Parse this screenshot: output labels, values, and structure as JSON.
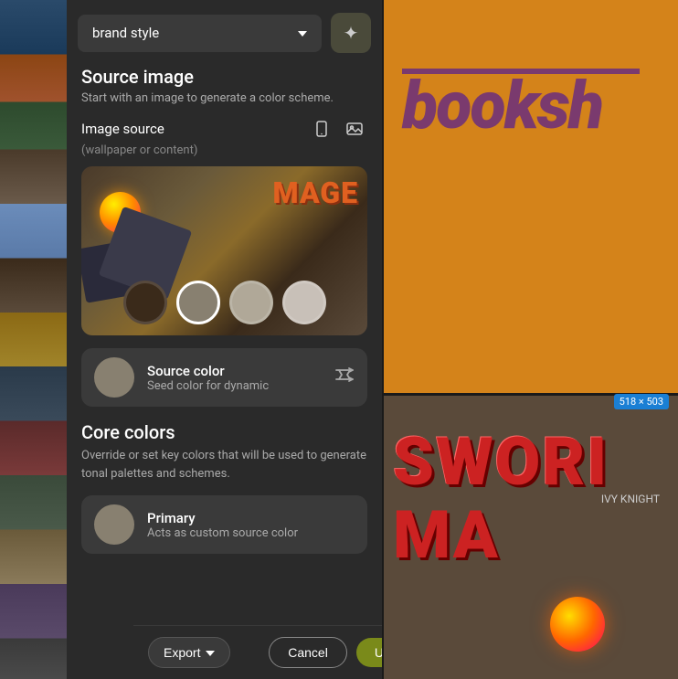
{
  "header": {
    "brand_label": "brand style",
    "magic_icon": "✦"
  },
  "source_image": {
    "title": "Source image",
    "subtitle": "Start with an image to generate a color scheme.",
    "image_source_label": "Image source",
    "wallpaper_label": "(wallpaper or content)",
    "swatches": [
      {
        "color": "#3a2a1a",
        "active": false
      },
      {
        "color": "#888070",
        "active": true
      },
      {
        "color": "#b0a898",
        "active": false
      },
      {
        "color": "#c8c0b8",
        "active": false
      }
    ]
  },
  "source_color": {
    "label": "Source color",
    "description": "Seed color for dynamic",
    "color": "#888070",
    "shuffle_icon": "⇄"
  },
  "core_colors": {
    "title": "Core colors",
    "subtitle": "Override or set key colors that will be used to generate tonal palettes and schemes.",
    "primary": {
      "label": "Primary",
      "description": "Acts as custom source color",
      "color": "#888070"
    }
  },
  "bottom_bar": {
    "export_label": "Export",
    "export_chevron": "▾",
    "cancel_label": "Cancel",
    "update_label": "Update"
  },
  "bg_top": {
    "text": "booksh",
    "dimensions": "518 × 503"
  },
  "bg_bottom": {
    "word1": "SWORI",
    "word2": "MA",
    "by_text": "IVY\nKNIGHT"
  }
}
